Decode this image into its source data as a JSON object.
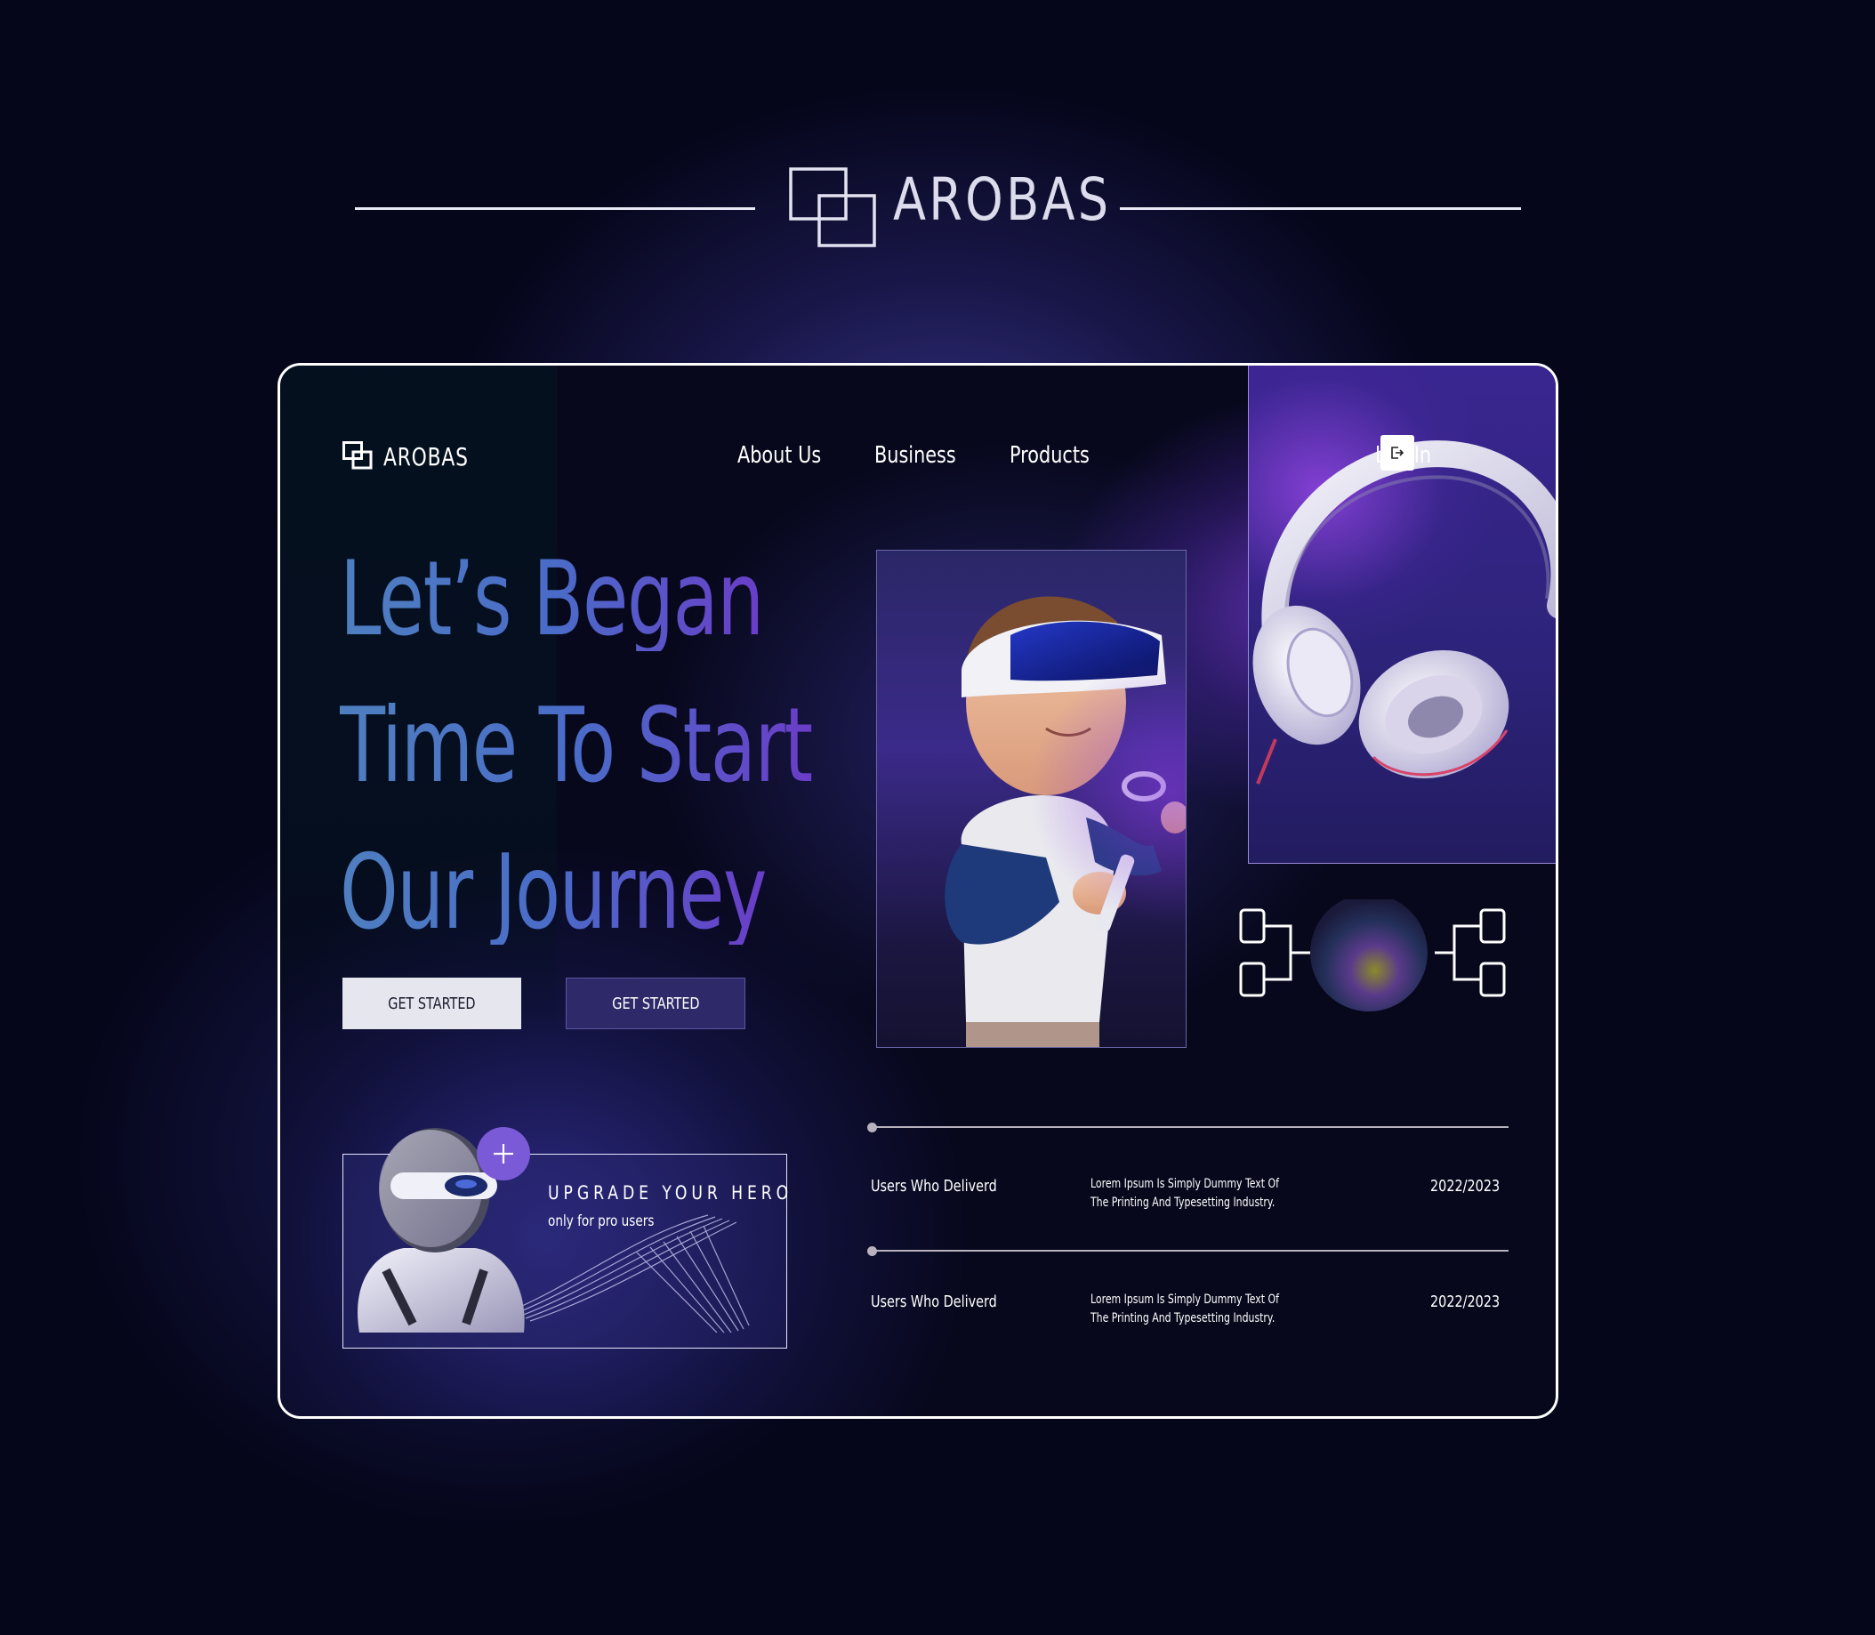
{
  "brand": {
    "name": "AROBAS"
  },
  "nav": {
    "brand": "AROBAS",
    "links": [
      "About Us",
      "Business",
      "Products"
    ],
    "login_label": "Log In"
  },
  "hero": {
    "lines": [
      "Let’s Began",
      "Time To Start",
      "Our Journey"
    ],
    "primary_button": "GET STARTED",
    "secondary_button": "GET STARTED"
  },
  "upgrade": {
    "title": "UPGRADE YOUR HERO",
    "subtitle": "only for pro users"
  },
  "stats": [
    {
      "label": "Users Who Deliverd",
      "desc_line1": "Lorem Ipsum Is Simply Dummy Text Of",
      "desc_line2": "The Printing And Typesetting Industry.",
      "year": "2022/2023"
    },
    {
      "label": "Users Who Deliverd",
      "desc_line1": "Lorem Ipsum Is Simply Dummy Text Of",
      "desc_line2": "The Printing And Typesetting Industry.",
      "year": "2022/2023"
    }
  ],
  "colors": {
    "background": "#05061a",
    "accent_purple": "#7a5ad6",
    "hero_gradient_start": "#4f7fc0",
    "hero_gradient_end": "#6a3dc8",
    "button_light": "#e6e6ee",
    "button_dark": "#2e2a6a"
  },
  "icons": {
    "logo": "overlapping-squares-icon",
    "login": "logout-arrow-icon",
    "plus": "plus-icon"
  }
}
